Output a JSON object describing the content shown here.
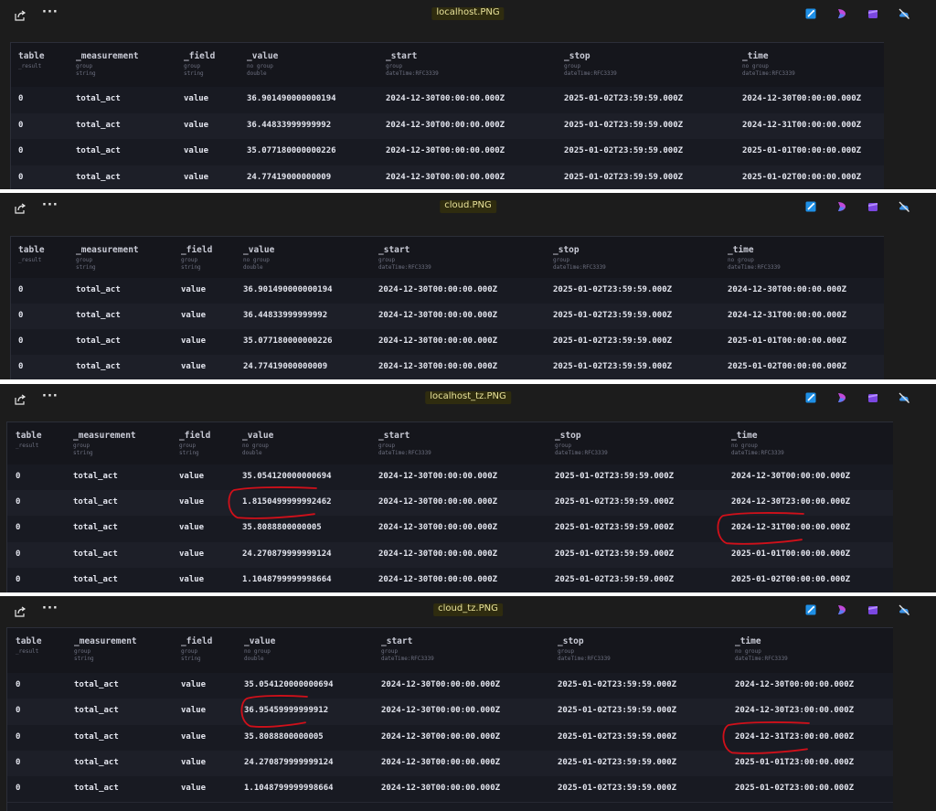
{
  "common": {
    "menu_label": "···",
    "columns": [
      {
        "name": "table",
        "sub1": "_result",
        "sub2": ""
      },
      {
        "name": "_measurement",
        "sub1": "group",
        "sub2": "string"
      },
      {
        "name": "_field",
        "sub1": "group",
        "sub2": "string"
      },
      {
        "name": "_value",
        "sub1": "no group",
        "sub2": "double"
      },
      {
        "name": "_start",
        "sub1": "group",
        "sub2": "dateTime:RFC3339"
      },
      {
        "name": "_stop",
        "sub1": "group",
        "sub2": "dateTime:RFC3339"
      },
      {
        "name": "_time",
        "sub1": "no group",
        "sub2": "dateTime:RFC3339"
      }
    ],
    "icons": [
      "edit-image-icon",
      "copilot-icon",
      "clipchamp-icon",
      "cloud-off-icon"
    ],
    "annotation_color": "#d0101a"
  },
  "panels": [
    {
      "filename": "localhost.PNG",
      "rows": [
        [
          "0",
          "total_act",
          "value",
          "36.901490000000194",
          "2024-12-30T00:00:00.000Z",
          "2025-01-02T23:59:59.000Z",
          "2024-12-30T00:00:00.000Z"
        ],
        [
          "0",
          "total_act",
          "value",
          "36.44833999999992",
          "2024-12-30T00:00:00.000Z",
          "2025-01-02T23:59:59.000Z",
          "2024-12-31T00:00:00.000Z"
        ],
        [
          "0",
          "total_act",
          "value",
          "35.077180000000226",
          "2024-12-30T00:00:00.000Z",
          "2025-01-02T23:59:59.000Z",
          "2025-01-01T00:00:00.000Z"
        ],
        [
          "0",
          "total_act",
          "value",
          "24.77419000000009",
          "2024-12-30T00:00:00.000Z",
          "2025-01-02T23:59:59.000Z",
          "2025-01-02T00:00:00.000Z"
        ]
      ]
    },
    {
      "filename": "cloud.PNG",
      "rows": [
        [
          "0",
          "total_act",
          "value",
          "36.901490000000194",
          "2024-12-30T00:00:00.000Z",
          "2025-01-02T23:59:59.000Z",
          "2024-12-30T00:00:00.000Z"
        ],
        [
          "0",
          "total_act",
          "value",
          "36.44833999999992",
          "2024-12-30T00:00:00.000Z",
          "2025-01-02T23:59:59.000Z",
          "2024-12-31T00:00:00.000Z"
        ],
        [
          "0",
          "total_act",
          "value",
          "35.077180000000226",
          "2024-12-30T00:00:00.000Z",
          "2025-01-02T23:59:59.000Z",
          "2025-01-01T00:00:00.000Z"
        ],
        [
          "0",
          "total_act",
          "value",
          "24.77419000000009",
          "2024-12-30T00:00:00.000Z",
          "2025-01-02T23:59:59.000Z",
          "2025-01-02T00:00:00.000Z"
        ]
      ]
    },
    {
      "filename": "localhost_tz.PNG",
      "rows": [
        [
          "0",
          "total_act",
          "value",
          "35.054120000000694",
          "2024-12-30T00:00:00.000Z",
          "2025-01-02T23:59:59.000Z",
          "2024-12-30T00:00:00.000Z"
        ],
        [
          "0",
          "total_act",
          "value",
          "1.8150499999992462",
          "2024-12-30T00:00:00.000Z",
          "2025-01-02T23:59:59.000Z",
          "2024-12-30T23:00:00.000Z"
        ],
        [
          "0",
          "total_act",
          "value",
          "35.8088800000005",
          "2024-12-30T00:00:00.000Z",
          "2025-01-02T23:59:59.000Z",
          "2024-12-31T00:00:00.000Z"
        ],
        [
          "0",
          "total_act",
          "value",
          "24.270879999999124",
          "2024-12-30T00:00:00.000Z",
          "2025-01-02T23:59:59.000Z",
          "2025-01-01T00:00:00.000Z"
        ],
        [
          "0",
          "total_act",
          "value",
          "1.1048799999998664",
          "2024-12-30T00:00:00.000Z",
          "2025-01-02T23:59:59.000Z",
          "2025-01-02T00:00:00.000Z"
        ]
      ]
    },
    {
      "filename": "cloud_tz.PNG",
      "rows": [
        [
          "0",
          "total_act",
          "value",
          "35.054120000000694",
          "2024-12-30T00:00:00.000Z",
          "2025-01-02T23:59:59.000Z",
          "2024-12-30T00:00:00.000Z"
        ],
        [
          "0",
          "total_act",
          "value",
          "36.95459999999912",
          "2024-12-30T00:00:00.000Z",
          "2025-01-02T23:59:59.000Z",
          "2024-12-30T23:00:00.000Z"
        ],
        [
          "0",
          "total_act",
          "value",
          "35.8088800000005",
          "2024-12-30T00:00:00.000Z",
          "2025-01-02T23:59:59.000Z",
          "2024-12-31T23:00:00.000Z"
        ],
        [
          "0",
          "total_act",
          "value",
          "24.270879999999124",
          "2024-12-30T00:00:00.000Z",
          "2025-01-02T23:59:59.000Z",
          "2025-01-01T23:00:00.000Z"
        ],
        [
          "0",
          "total_act",
          "value",
          "1.1048799999998664",
          "2024-12-30T00:00:00.000Z",
          "2025-01-02T23:59:59.000Z",
          "2025-01-02T23:00:00.000Z"
        ]
      ]
    }
  ]
}
